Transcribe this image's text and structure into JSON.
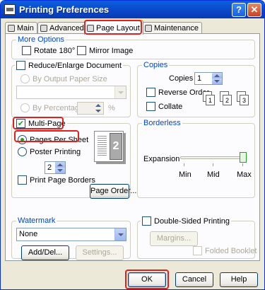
{
  "window": {
    "title": "Printing Preferences",
    "help_label": "?",
    "close_label": "✕"
  },
  "tabs": [
    {
      "label": "Main"
    },
    {
      "label": "Advanced"
    },
    {
      "label": "Page Layout"
    },
    {
      "label": "Maintenance"
    }
  ],
  "more_options": {
    "title": "More Options",
    "rotate_label": "Rotate 180°",
    "rotate_checked": false,
    "mirror_label": "Mirror Image",
    "mirror_checked": false
  },
  "reduce_enlarge": {
    "title": "Reduce/Enlarge Document",
    "checked": false,
    "by_output_label": "By Output Paper Size",
    "paper_size_value": "",
    "by_percentage_label": "By Percentage",
    "percentage_value": "",
    "percent_sign": "%"
  },
  "copies": {
    "title": "Copies",
    "copies_label": "Copies",
    "copies_value": "1",
    "reverse_label": "Reverse Order",
    "reverse_checked": false,
    "collate_label": "Collate",
    "collate_checked": false,
    "collate_numbers": [
      "1",
      "2",
      "3"
    ]
  },
  "multipage": {
    "label": "Multi-Page",
    "checked": true,
    "pages_per_sheet_label": "Pages Per Sheet",
    "pages_per_sheet_selected": true,
    "poster_label": "Poster Printing",
    "poster_selected": false,
    "pages_value": "2",
    "preview_number": "2",
    "print_borders_label": "Print Page Borders",
    "print_borders_checked": false,
    "page_order_label": "Page Order..."
  },
  "borderless": {
    "title": "Borderless",
    "expansion_label": "Expansion",
    "expansion_level": "Max",
    "min_label": "Min",
    "mid_label": "Mid",
    "max_label": "Max"
  },
  "watermark": {
    "title": "Watermark",
    "selected": "None",
    "add_del_label": "Add/Del...",
    "settings_label": "Settings..."
  },
  "double_sided": {
    "label": "Double-Sided Printing",
    "checked": false,
    "margins_label": "Margins...",
    "folded_booklet_label": "Folded Booklet",
    "folded_booklet_checked": false
  },
  "footer": {
    "ok_label": "OK",
    "cancel_label": "Cancel",
    "help_label": "Help"
  },
  "colors": {
    "highlight": "#e0201c",
    "group_title": "#0046d5",
    "titlebar": "#0b48c9"
  }
}
